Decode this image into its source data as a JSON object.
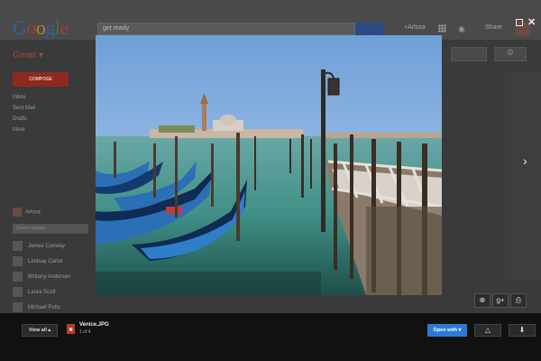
{
  "gmail": {
    "search_value": "get ready",
    "user_name": "+Arlssa",
    "share_label": "Share",
    "app_label": "Gmail",
    "compose_label": "COMPOSE",
    "nav": [
      "Inbox",
      "Sent Mail",
      "Drafts",
      "More"
    ],
    "chat_user": "Arlssa",
    "chat_search_placeholder": "Search people",
    "contacts": [
      "James Conway",
      "Lindsay Carter",
      "Brittany Andersen",
      "Laura Scott",
      "Michael Potts"
    ]
  },
  "viewer": {
    "file_name": "Venice.JPG",
    "file_count": "1 of 4",
    "file_type": "JPG",
    "view_all_label": "View all",
    "open_with_label": "Open with",
    "colors": {
      "open_with": "#2e7ad3",
      "bottombar": "#111111",
      "file_icon": "#c0392b"
    }
  }
}
